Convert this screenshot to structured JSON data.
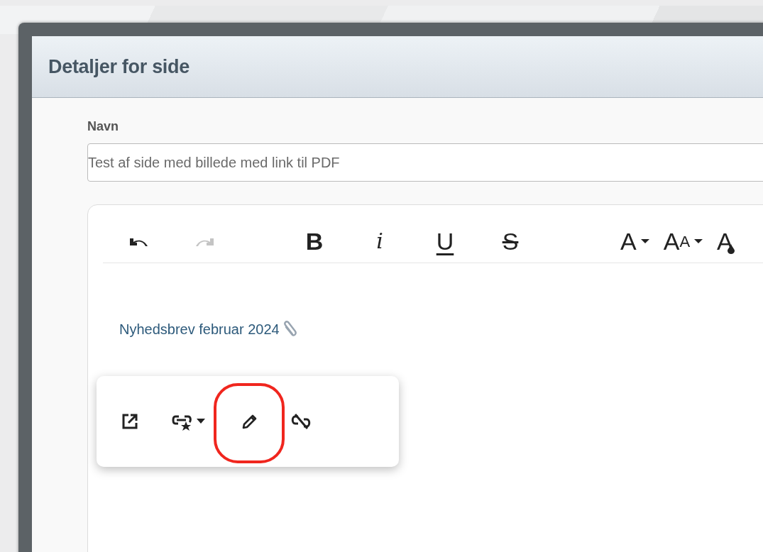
{
  "window": {
    "title": "Detaljer for side"
  },
  "name_field": {
    "label": "Navn",
    "value": "Test af side med billede med link til PDF"
  },
  "toolbar": {
    "groups": [
      [
        {
          "kind": "undo",
          "disabled": false
        },
        {
          "kind": "redo",
          "disabled": true
        }
      ],
      [
        {
          "kind": "bold",
          "label": "B",
          "disabled": false
        },
        {
          "kind": "italic",
          "label": "i",
          "disabled": false
        },
        {
          "kind": "underline",
          "label": "U",
          "disabled": false
        },
        {
          "kind": "strike",
          "label": "S",
          "disabled": false
        }
      ],
      [
        {
          "kind": "font",
          "label": "A",
          "disabled": false
        },
        {
          "kind": "size",
          "label": "A",
          "small": "A",
          "disabled": false
        },
        {
          "kind": "color",
          "label": "A",
          "disabled": false
        }
      ]
    ]
  },
  "content": {
    "link": "Nyhedsbrev februar 2024"
  },
  "link_popup": {
    "buttons": [
      {
        "kind": "open",
        "highlighted": false
      },
      {
        "kind": "style",
        "highlighted": false
      },
      {
        "kind": "edit",
        "highlighted": true
      },
      {
        "kind": "unlink",
        "highlighted": false
      }
    ]
  }
}
